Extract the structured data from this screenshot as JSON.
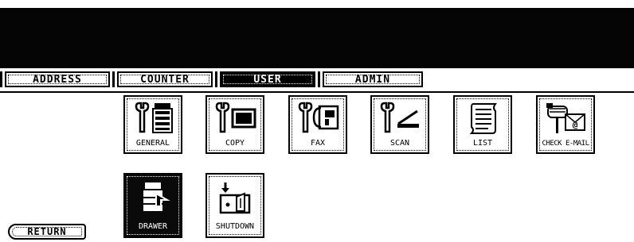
{
  "tabs": [
    {
      "label": "ADDRESS",
      "active": false
    },
    {
      "label": "COUNTER",
      "active": false
    },
    {
      "label": "USER",
      "active": true
    },
    {
      "label": "ADMIN",
      "active": false
    }
  ],
  "tiles_row1": [
    {
      "label": "GENERAL",
      "icon": "wrench-copier-icon"
    },
    {
      "label": "COPY",
      "icon": "wrench-document-icon"
    },
    {
      "label": "FAX",
      "icon": "wrench-fax-icon"
    },
    {
      "label": "SCAN",
      "icon": "wrench-scanner-icon"
    },
    {
      "label": "LIST",
      "icon": "scroll-list-icon"
    },
    {
      "label": "CHECK E-MAIL",
      "icon": "mailbox-email-icon"
    }
  ],
  "tiles_row2": [
    {
      "label": "DRAWER",
      "icon": "copier-drawer-icon",
      "selected": true
    },
    {
      "label": "SHUTDOWN",
      "icon": "power-switch-icon",
      "selected": false
    }
  ],
  "return_label": "RETURN"
}
